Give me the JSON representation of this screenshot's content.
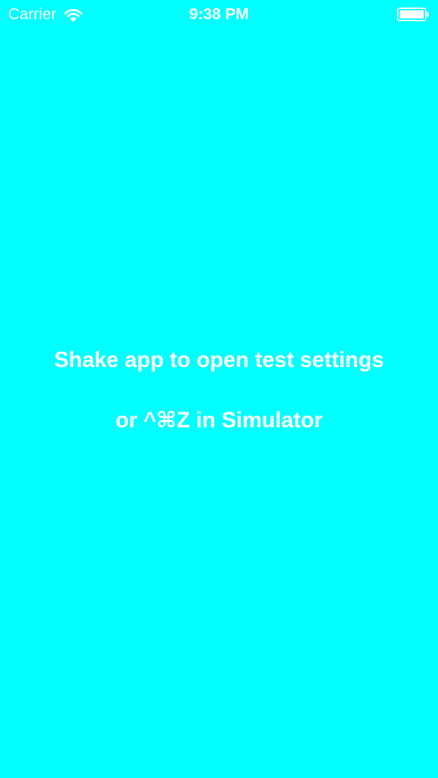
{
  "status_bar": {
    "carrier": "Carrier",
    "time": "9:38 PM",
    "wifi_icon": "wifi-icon",
    "battery_icon": "battery-icon"
  },
  "message": {
    "line1": "Shake app to open test settings",
    "line2": "or ^⌘Z in Simulator"
  },
  "colors": {
    "background": "#00FFFF",
    "text": "#FFFFFF"
  }
}
